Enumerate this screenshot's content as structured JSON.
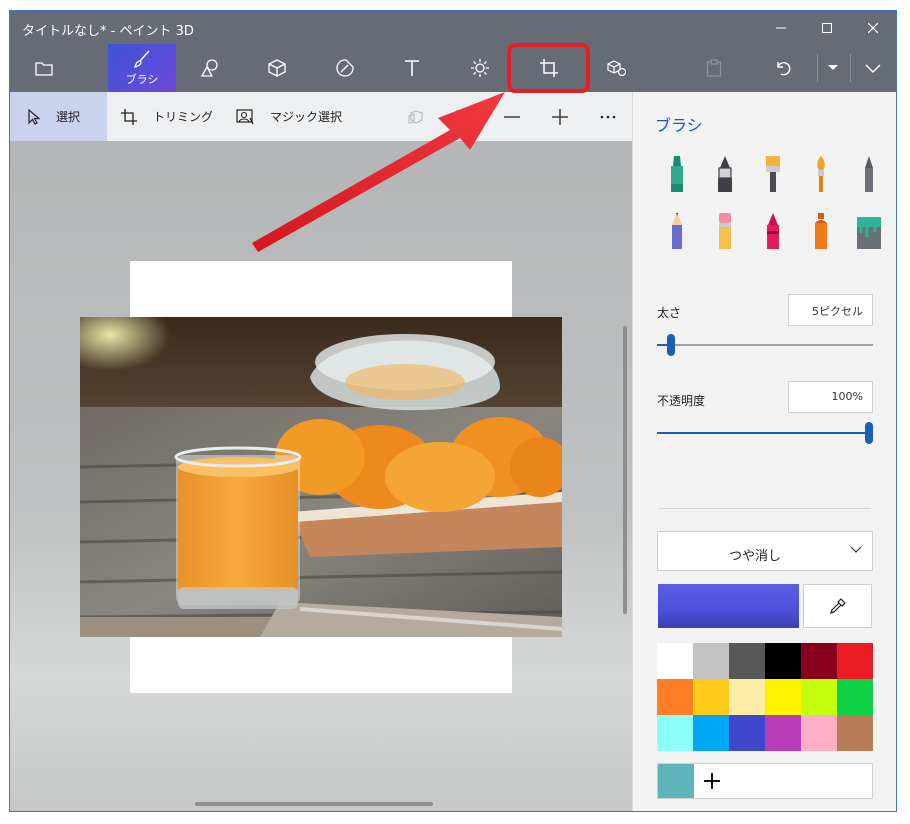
{
  "window": {
    "title": "タイトルなし* - ペイント 3D"
  },
  "toolbar": {
    "brush_label": "ブラシ",
    "active_tool": "brush",
    "highlighted_tool": "canvas"
  },
  "subbar": {
    "select_label": "選択",
    "crop_label": "トリミング",
    "magic_select_label": "マジック選択"
  },
  "panel": {
    "title": "ブラシ",
    "thickness_label": "太さ",
    "thickness_value": "5ピクセル",
    "thickness_level": 0.05,
    "opacity_label": "不透明度",
    "opacity_value": "100%",
    "opacity_level": 1.0,
    "finish_value": "つや消し",
    "current_color": "#4b50d8",
    "custom_color": "#5fb3bb",
    "palette": [
      "#ffffff",
      "#c3c3c3",
      "#585858",
      "#000000",
      "#88001b",
      "#ec1c24",
      "#ff7f27",
      "#ffca18",
      "#fdeca6",
      "#fff200",
      "#c4ff0e",
      "#0ed145",
      "#8cfffb",
      "#00a8f3",
      "#3f48cc",
      "#b83dba",
      "#ffaec8",
      "#b97a56"
    ]
  },
  "colors": {
    "chrome": "#666b75",
    "accent": "#1a5fb4",
    "highlight": "#e61e24"
  }
}
